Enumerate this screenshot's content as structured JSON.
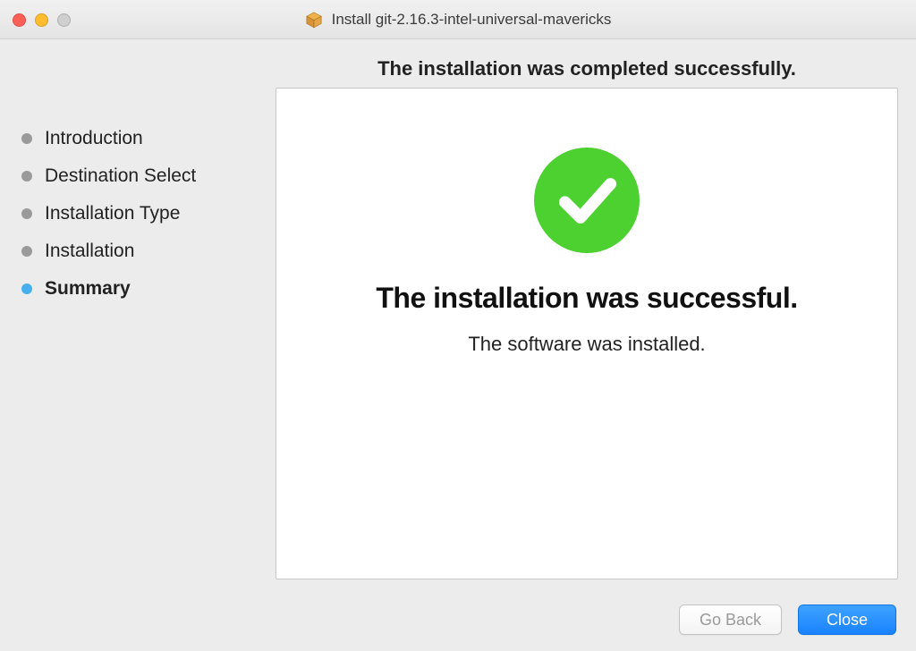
{
  "window": {
    "title": "Install git-2.16.3-intel-universal-mavericks"
  },
  "headline": "The installation was completed successfully.",
  "steps": [
    {
      "label": "Introduction",
      "active": false
    },
    {
      "label": "Destination Select",
      "active": false
    },
    {
      "label": "Installation Type",
      "active": false
    },
    {
      "label": "Installation",
      "active": false
    },
    {
      "label": "Summary",
      "active": true
    }
  ],
  "panel": {
    "title": "The installation was successful.",
    "subtitle": "The software was installed."
  },
  "footer": {
    "go_back_label": "Go Back",
    "close_label": "Close"
  }
}
